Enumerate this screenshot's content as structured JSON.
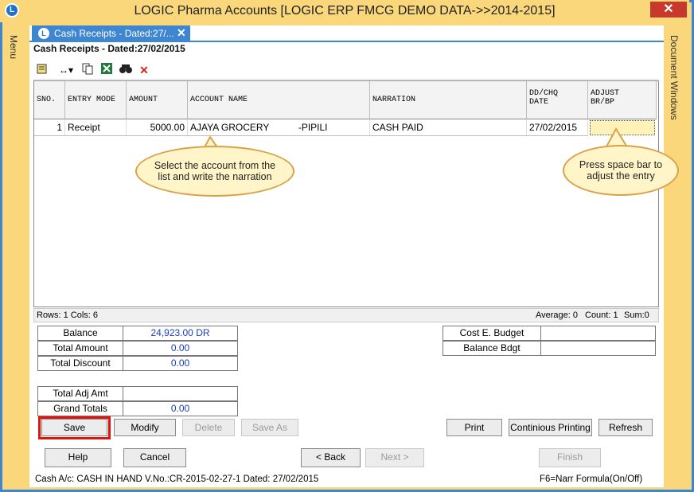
{
  "window": {
    "title": "LOGIC Pharma Accounts  [LOGIC ERP FMCG DEMO DATA->>2014-2015]",
    "close_glyph": "✕",
    "menu_label": "Menu",
    "doc_windows_label": "Document Windows"
  },
  "tab": {
    "label": "Cash Receipts - Dated:27/...",
    "close_glyph": "✕"
  },
  "form_title": "Cash Receipts - Dated:27/02/2015",
  "toolbar": {
    "icons": [
      "notes-icon",
      "column-width-icon",
      "copy-icon",
      "excel-icon",
      "find-icon",
      "delete-icon"
    ]
  },
  "grid": {
    "headers": [
      "SNO.",
      "ENTRY MODE",
      "AMOUNT",
      "ACCOUNT NAME",
      "NARRATION",
      "DD/CHQ\nDATE",
      "ADJUST\nBR/BP"
    ],
    "rows": [
      {
        "sno": "1",
        "mode": "Receipt",
        "amount": "5000.00",
        "account": "AJAYA GROCERY           -PIPILI",
        "narration": "CASH PAID",
        "date": "27/02/2015",
        "adjust": ""
      }
    ]
  },
  "statusbar": {
    "rows_cols": "Rows: 1  Cols: 6",
    "average": "Average: 0",
    "count": "Count: 1",
    "sum": "Sum:0"
  },
  "callouts": {
    "account": "Select the account from the list and write the narration",
    "adjust": "Press space bar to adjust the entry"
  },
  "summary": {
    "balance_label": "Balance",
    "balance_value": "24,923.00 DR",
    "total_amount_label": "Total Amount",
    "total_amount_value": "0.00",
    "total_discount_label": "Total Discount",
    "total_discount_value": "0.00",
    "total_adj_label": "Total Adj Amt",
    "total_adj_value": "",
    "grand_totals_label": "Grand Totals",
    "grand_totals_value": "0.00",
    "cost_budget_label": "Cost E. Budget",
    "cost_budget_value": "",
    "balance_bdgt_label": "Balance Bdgt",
    "balance_bdgt_value": ""
  },
  "buttons": {
    "save": "Save",
    "modify": "Modify",
    "delete": "Delete",
    "save_as": "Save As",
    "print": "Print",
    "continuous_printing": "Continious Printing",
    "refresh": "Refresh",
    "help": "Help",
    "cancel": "Cancel",
    "back": "< Back",
    "next": "Next >",
    "finish": "Finish"
  },
  "footer": {
    "left": "Cash A/c: CASH IN HAND V.No.:CR-2015-02-27-1 Dated: 27/02/2015",
    "right": "F6=Narr Formula(On/Off)"
  },
  "colors": {
    "accent": "#3f86d0",
    "frame": "#f9d77a",
    "highlight": "#e3120b",
    "callout_fill": "#fff5c8"
  }
}
